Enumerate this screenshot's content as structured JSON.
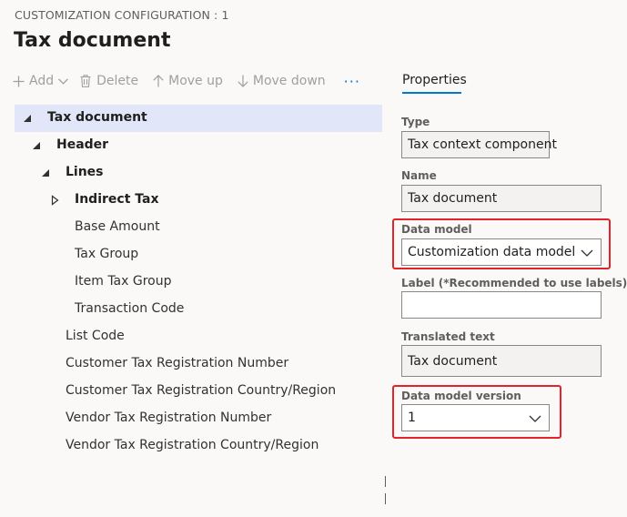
{
  "header": {
    "caption": "CUSTOMIZATION CONFIGURATION : 1",
    "title": "Tax document"
  },
  "toolbar": {
    "add_label": "Add",
    "delete_label": "Delete",
    "move_up_label": "Move up",
    "move_down_label": "Move down",
    "more_label": "···"
  },
  "tree": {
    "items": [
      {
        "label": "Tax document",
        "expanded": true,
        "selected": true
      },
      {
        "label": "Header",
        "expanded": true
      },
      {
        "label": "Lines",
        "expanded": true
      },
      {
        "label": "Indirect Tax",
        "expanded": false
      },
      {
        "label": "Base Amount"
      },
      {
        "label": "Tax Group"
      },
      {
        "label": "Item Tax Group"
      },
      {
        "label": "Transaction Code"
      },
      {
        "label": "List Code"
      },
      {
        "label": "Customer Tax Registration Number"
      },
      {
        "label": "Customer Tax Registration Country/Region"
      },
      {
        "label": "Vendor Tax Registration Number"
      },
      {
        "label": "Vendor Tax Registration Country/Region"
      }
    ]
  },
  "properties": {
    "tab_label": "Properties",
    "type_label": "Type",
    "type_value": "Tax context component",
    "name_label": "Name",
    "name_value": "Tax document",
    "data_model_label": "Data model",
    "data_model_value": "Customization data model",
    "label_label": "Label (*Recommended to use labels)",
    "label_value": "",
    "translated_label": "Translated text",
    "translated_value": "Tax document",
    "data_model_version_label": "Data model version",
    "data_model_version_value": "1"
  },
  "colors": {
    "accent": "#0078d4",
    "highlight_border": "#e2232b",
    "selected_row": "#e1e7f8",
    "disabled_text": "#a19f9d"
  }
}
